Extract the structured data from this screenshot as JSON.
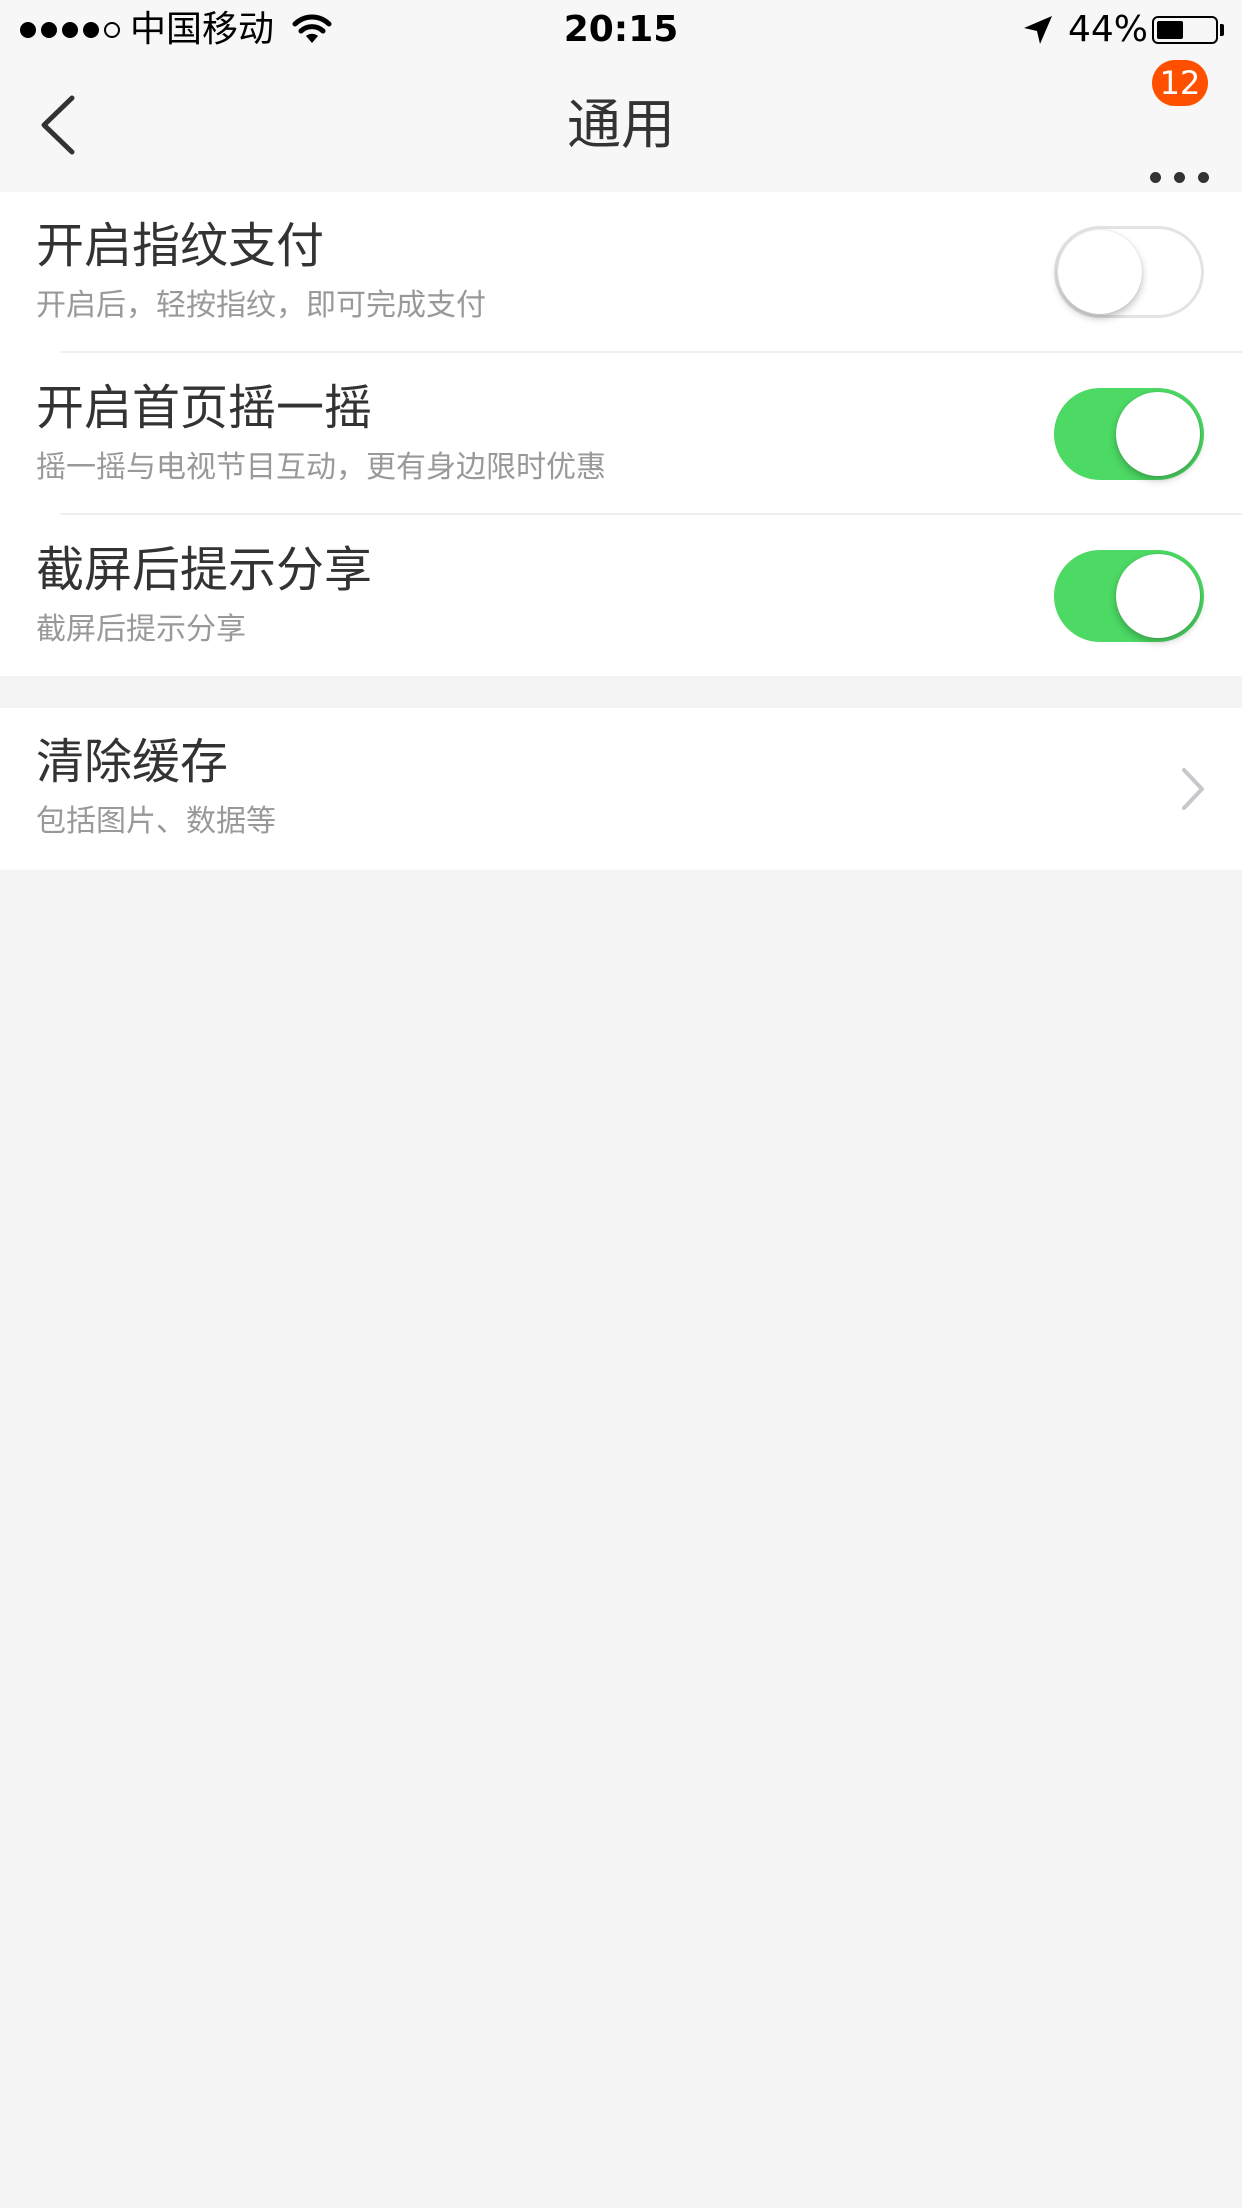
{
  "status_bar": {
    "carrier": "中国移动",
    "time": "20:15",
    "battery_percent": "44%",
    "battery_level": 0.44,
    "signal_strength": 4,
    "signal_max": 5,
    "icons": [
      "signal-dots-icon",
      "wifi-icon",
      "location-arrow-icon",
      "battery-icon"
    ]
  },
  "nav": {
    "title": "通用",
    "back_icon": "chevron-left-icon",
    "more_icon": "more-dots-icon",
    "badge_count": "12"
  },
  "settings": {
    "group_1": [
      {
        "title": "开启指纹支付",
        "subtitle": "开启后，轻按指纹，即可完成支付",
        "enabled": false
      },
      {
        "title": "开启首页摇一摇",
        "subtitle": "摇一摇与电视节目互动，更有身边限时优惠",
        "enabled": true
      },
      {
        "title": "截屏后提示分享",
        "subtitle": "截屏后提示分享",
        "enabled": true
      }
    ],
    "group_2": [
      {
        "title": "清除缓存",
        "subtitle": "包括图片、数据等",
        "icon": "chevron-right-icon"
      }
    ]
  },
  "colors": {
    "toggle_on": "#4cd964",
    "badge": "#ff5000",
    "background": "#f4f4f4"
  }
}
